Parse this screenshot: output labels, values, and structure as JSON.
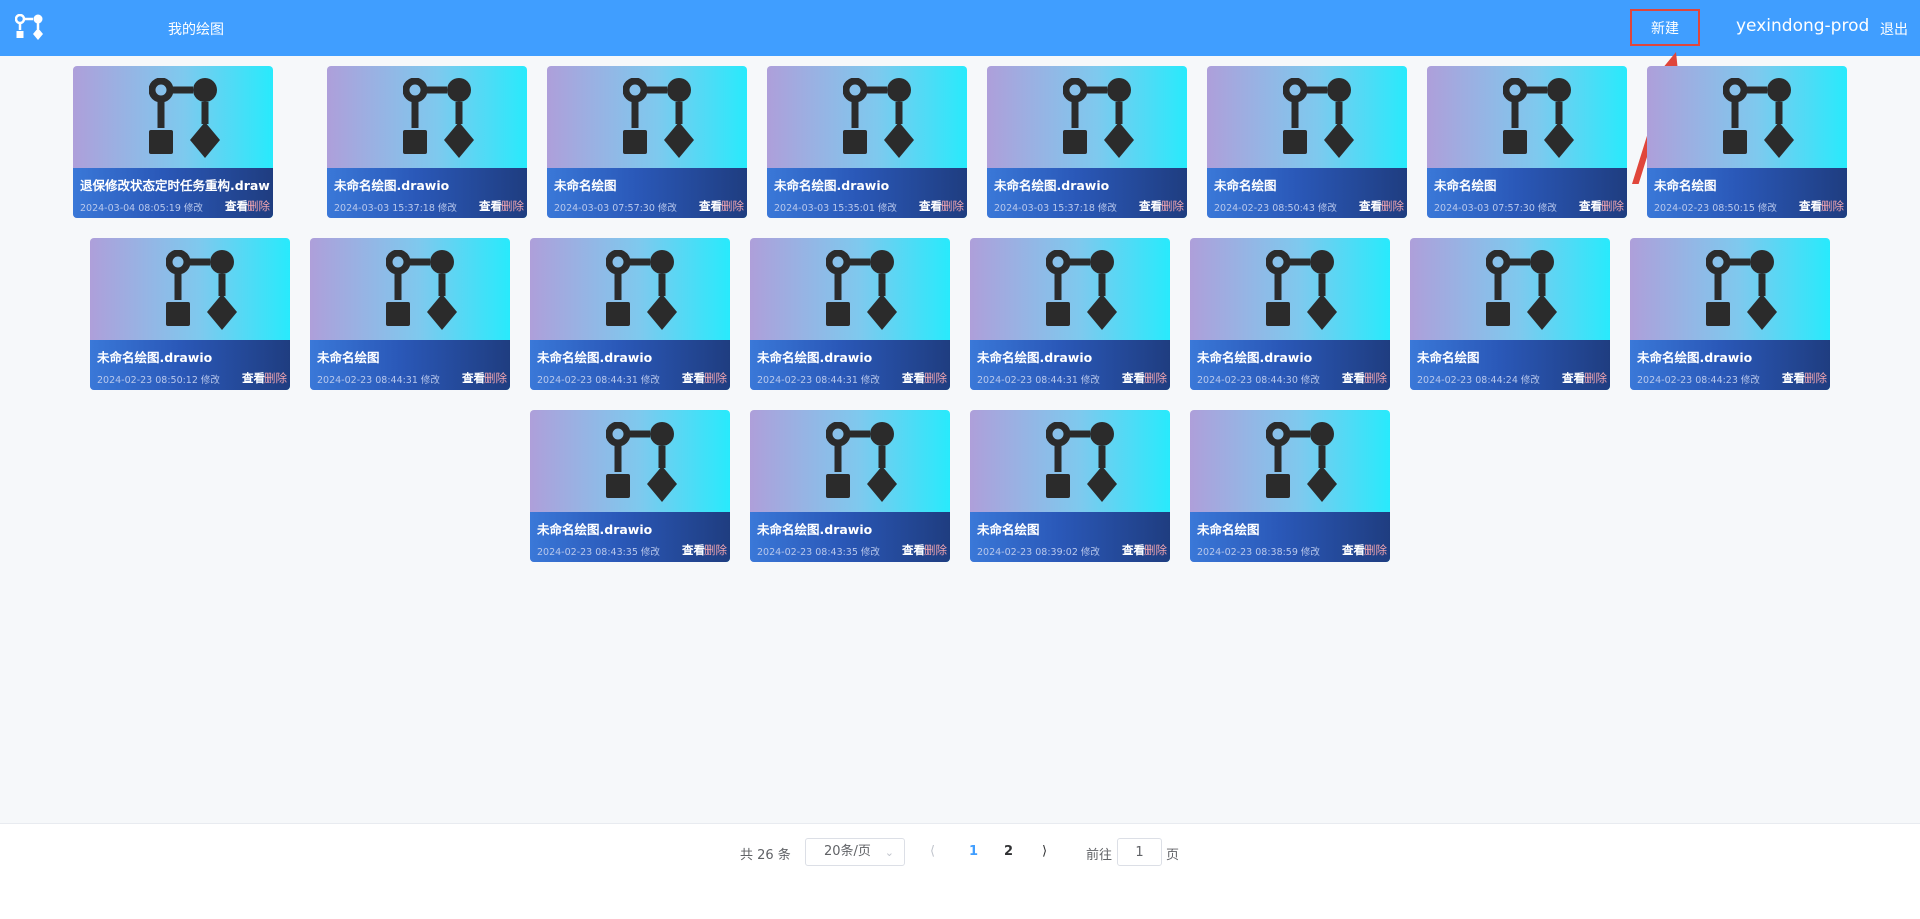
{
  "header": {
    "nav_title": "我的绘图",
    "new_label": "新建",
    "username": "yexindong-prod",
    "logout_label": "退出"
  },
  "card_actions": {
    "view": "查看",
    "delete": "删除"
  },
  "cards": [
    {
      "name": "退保修改状态定时任务重构.drawio",
      "time": "2024-03-04 08:05:19 修改"
    },
    {
      "name": "未命名绘图.drawio",
      "time": "2024-03-03 15:37:18 修改"
    },
    {
      "name": "未命名绘图",
      "time": "2024-03-03 07:57:30 修改"
    },
    {
      "name": "未命名绘图.drawio",
      "time": "2024-03-03 15:35:01 修改"
    },
    {
      "name": "未命名绘图.drawio",
      "time": "2024-03-03 15:37:18 修改"
    },
    {
      "name": "未命名绘图",
      "time": "2024-02-23 08:50:43 修改"
    },
    {
      "name": "未命名绘图",
      "time": "2024-03-03 07:57:30 修改"
    },
    {
      "name": "未命名绘图",
      "time": "2024-02-23 08:50:15 修改"
    },
    {
      "name": "未命名绘图.drawio",
      "time": "2024-02-23 08:50:12 修改"
    },
    {
      "name": "未命名绘图",
      "time": "2024-02-23 08:44:31 修改"
    },
    {
      "name": "未命名绘图.drawio",
      "time": "2024-02-23 08:44:31 修改"
    },
    {
      "name": "未命名绘图.drawio",
      "time": "2024-02-23 08:44:31 修改"
    },
    {
      "name": "未命名绘图.drawio",
      "time": "2024-02-23 08:44:31 修改"
    },
    {
      "name": "未命名绘图.drawio",
      "time": "2024-02-23 08:44:30 修改"
    },
    {
      "name": "未命名绘图",
      "time": "2024-02-23 08:44:24 修改"
    },
    {
      "name": "未命名绘图.drawio",
      "time": "2024-02-23 08:44:23 修改"
    },
    {
      "name": "未命名绘图.drawio",
      "time": "2024-02-23 08:43:35 修改"
    },
    {
      "name": "未命名绘图.drawio",
      "time": "2024-02-23 08:43:35 修改"
    },
    {
      "name": "未命名绘图",
      "time": "2024-02-23 08:39:02 修改"
    },
    {
      "name": "未命名绘图",
      "time": "2024-02-23 08:38:59 修改"
    }
  ],
  "pagination": {
    "total": "共 26 条",
    "page_size": "20条/页",
    "pages": [
      "1",
      "2"
    ],
    "current_page": "1",
    "goto_label": "前往",
    "goto_value": "1",
    "goto_suffix": "页"
  },
  "colors": {
    "header_bg": "#409eff",
    "highlight_border": "#e0463b",
    "active_page": "#409eff"
  }
}
